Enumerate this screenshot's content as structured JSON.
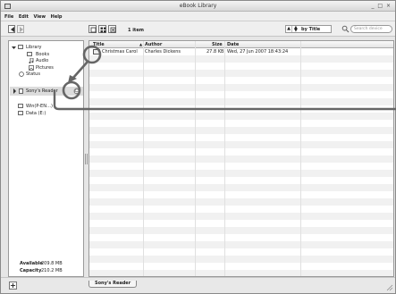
{
  "window": {
    "title": "eBook Library",
    "controls": "_ □ ×"
  },
  "menu": [
    "File",
    "Edit",
    "View",
    "Help"
  ],
  "toolbar": {
    "item_count": "1 item",
    "sort_value": "by Title",
    "search_placeholder": "Search device"
  },
  "sidebar": {
    "library": "Library",
    "books": "Books",
    "audio": "Audio",
    "pictures": "Pictures",
    "status": "Status",
    "reader": "Sony's Reader",
    "drive_win": "Win(P-EN…)",
    "drive_data": "Data (E:)",
    "available_label": "Available",
    "available_value": "209.8 MB",
    "capacity_label": "Capacity",
    "capacity_value": "210.2 MB"
  },
  "table": {
    "columns": [
      "Title",
      "Author",
      "Size",
      "Date"
    ],
    "rows": [
      {
        "title": "Christmas Carol",
        "author": "Charles Dickens",
        "size": "27.8 KB",
        "date": "Wed, 27 Jun 2007 18:43:24"
      }
    ]
  },
  "statusbar": {
    "tab_label": "Sony's Reader"
  },
  "colors": {
    "callout": "#666666",
    "chrome": "#e6e6e6",
    "row_alt": "#f1f1f1"
  },
  "icons": [
    "book-icon",
    "search-icon",
    "eject-icon",
    "add-icon"
  ]
}
